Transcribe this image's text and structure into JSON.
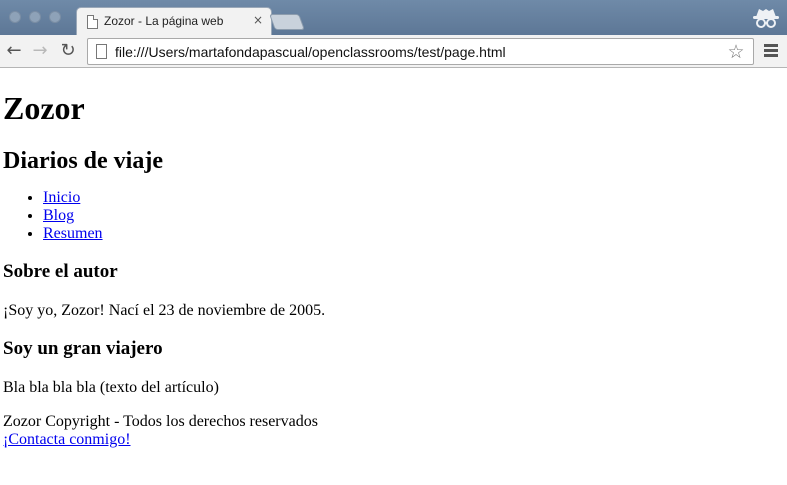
{
  "browser": {
    "tab_title": "Zozor - La página web",
    "tab_close": "×",
    "url": "file:///Users/martafondapascual/openclassrooms/test/page.html",
    "icons": {
      "back": "arrow-left-icon",
      "forward": "arrow-right-icon",
      "reload": "reload-icon",
      "bookmark": "star-icon",
      "menu": "hamburger-menu-icon",
      "profile": "incognito-icon"
    }
  },
  "page": {
    "site_title": "Zozor",
    "subtitle": "Diarios de viaje",
    "nav": [
      {
        "label": "Inicio"
      },
      {
        "label": "Blog"
      },
      {
        "label": "Resumen"
      }
    ],
    "about_heading": "Sobre el autor",
    "about_text": "¡Soy yo, Zozor! Nací el 23 de noviembre de 2005.",
    "article_heading": "Soy un gran viajero",
    "article_text": "Bla bla bla bla (texto del artículo)",
    "footer_text": "Zozor Copyright - Todos los derechos reservados",
    "contact_link": "¡Contacta conmigo!"
  },
  "colors": {
    "link": "#0000ee",
    "tabstrip": "#6f8aa8",
    "toolbar": "#f2f2f2"
  }
}
